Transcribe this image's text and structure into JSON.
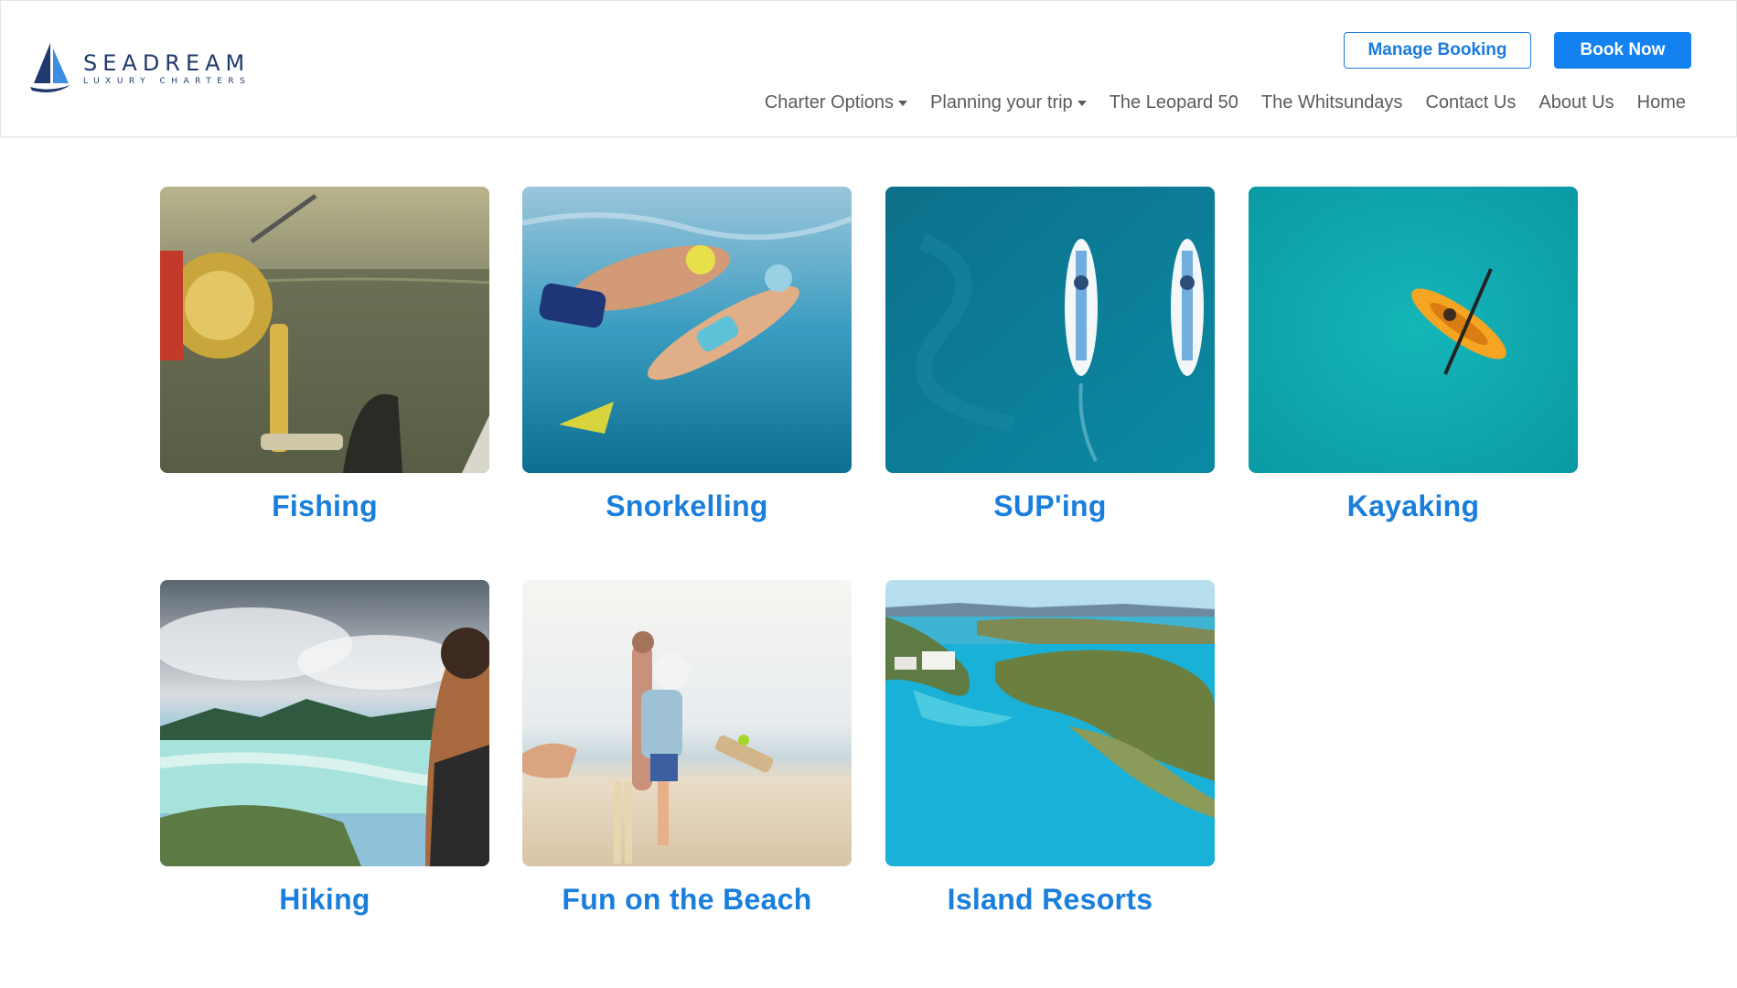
{
  "brand": {
    "name": "SEADREAM",
    "tagline": "LUXURY CHARTERS",
    "logo_icon": "sailboat-logo",
    "color": "#1f3a6e"
  },
  "header": {
    "manage_booking_label": "Manage Booking",
    "book_now_label": "Book Now",
    "accent_color": "#1381f0"
  },
  "nav": {
    "items": [
      {
        "label": "Charter Options",
        "has_dropdown": true
      },
      {
        "label": "Planning your trip",
        "has_dropdown": true
      },
      {
        "label": "The Leopard 50",
        "has_dropdown": false
      },
      {
        "label": "The Whitsundays",
        "has_dropdown": false
      },
      {
        "label": "Contact Us",
        "has_dropdown": false
      },
      {
        "label": "About Us",
        "has_dropdown": false
      },
      {
        "label": "Home",
        "has_dropdown": false
      }
    ]
  },
  "activities": [
    {
      "title": "Fishing",
      "image": "fishing-reel-photo"
    },
    {
      "title": "Snorkelling",
      "image": "snorkelling-couple-photo"
    },
    {
      "title": "SUP'ing",
      "image": "paddleboarders-aerial-photo"
    },
    {
      "title": "Kayaking",
      "image": "kayak-aerial-photo"
    },
    {
      "title": "Hiking",
      "image": "hiking-lookout-photo"
    },
    {
      "title": "Fun on the Beach",
      "image": "beach-cricket-photo"
    },
    {
      "title": "Island Resorts",
      "image": "island-resort-aerial-photo"
    }
  ]
}
